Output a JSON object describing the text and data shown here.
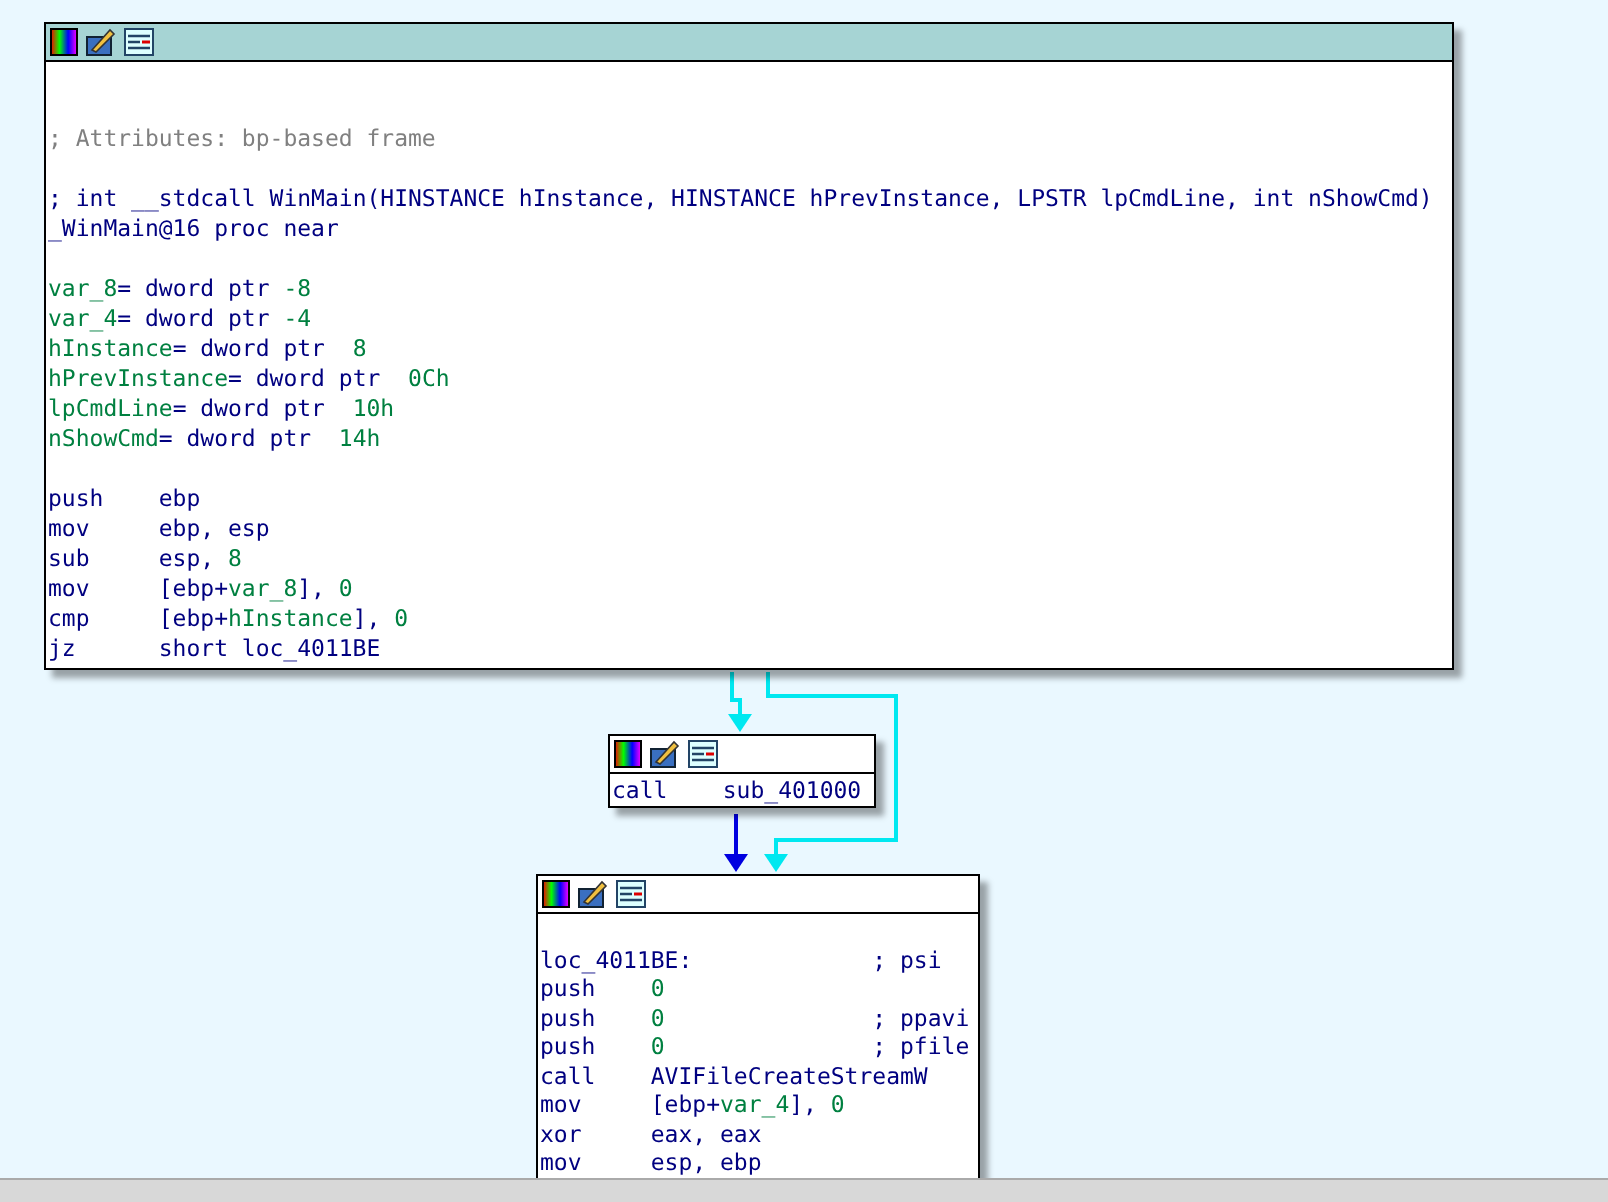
{
  "nodes": [
    {
      "lines": [
        {
          "kind": "blank"
        },
        {
          "kind": "blank"
        },
        {
          "kind": "note",
          "text": "; Attributes: bp-based frame"
        },
        {
          "kind": "blank"
        },
        {
          "kind": "proto",
          "text": "; int __stdcall WinMain(HINSTANCE hInstance, HINSTANCE hPrevInstance, LPSTR lpCmdLine, int nShowCmd)"
        },
        {
          "kind": "proto",
          "text": "_WinMain@16 proc near"
        },
        {
          "kind": "blank"
        },
        {
          "kind": "def",
          "tokens": [
            {
              "text": "var_8",
              "kind": "num"
            },
            {
              "text": "= dword ptr ",
              "kind": "code"
            },
            {
              "text": "-8",
              "kind": "num"
            }
          ]
        },
        {
          "kind": "def",
          "tokens": [
            {
              "text": "var_4",
              "kind": "num"
            },
            {
              "text": "= dword ptr ",
              "kind": "code"
            },
            {
              "text": "-4",
              "kind": "num"
            }
          ]
        },
        {
          "kind": "def",
          "tokens": [
            {
              "text": "hInstance",
              "kind": "num"
            },
            {
              "text": "= dword ptr  ",
              "kind": "code"
            },
            {
              "text": "8",
              "kind": "num"
            }
          ]
        },
        {
          "kind": "def",
          "tokens": [
            {
              "text": "hPrevInstance",
              "kind": "num"
            },
            {
              "text": "= dword ptr  ",
              "kind": "code"
            },
            {
              "text": "0Ch",
              "kind": "num"
            }
          ]
        },
        {
          "kind": "def",
          "tokens": [
            {
              "text": "lpCmdLine",
              "kind": "num"
            },
            {
              "text": "= dword ptr  ",
              "kind": "code"
            },
            {
              "text": "10h",
              "kind": "num"
            }
          ]
        },
        {
          "kind": "def",
          "tokens": [
            {
              "text": "nShowCmd",
              "kind": "num"
            },
            {
              "text": "= dword ptr  ",
              "kind": "code"
            },
            {
              "text": "14h",
              "kind": "num"
            }
          ]
        },
        {
          "kind": "blank"
        },
        {
          "kind": "insn",
          "mnemonic": "push",
          "tokens": [
            {
              "text": "ebp",
              "kind": "code"
            }
          ]
        },
        {
          "kind": "insn",
          "mnemonic": "mov",
          "tokens": [
            {
              "text": "ebp, esp",
              "kind": "code"
            }
          ]
        },
        {
          "kind": "insn",
          "mnemonic": "sub",
          "tokens": [
            {
              "text": "esp, ",
              "kind": "code"
            },
            {
              "text": "8",
              "kind": "num"
            }
          ]
        },
        {
          "kind": "insn",
          "mnemonic": "mov",
          "tokens": [
            {
              "text": "[ebp+",
              "kind": "code"
            },
            {
              "text": "var_8",
              "kind": "num"
            },
            {
              "text": "], ",
              "kind": "code"
            },
            {
              "text": "0",
              "kind": "num"
            }
          ]
        },
        {
          "kind": "insn",
          "mnemonic": "cmp",
          "tokens": [
            {
              "text": "[ebp+",
              "kind": "code"
            },
            {
              "text": "hInstance",
              "kind": "num"
            },
            {
              "text": "], ",
              "kind": "code"
            },
            {
              "text": "0",
              "kind": "num"
            }
          ]
        },
        {
          "kind": "insn",
          "mnemonic": "jz",
          "tokens": [
            {
              "text": "short loc_4011BE",
              "kind": "code"
            }
          ]
        }
      ]
    },
    {
      "lines": [
        {
          "kind": "insn",
          "mnemonic": "call",
          "tokens": [
            {
              "text": "sub_401000",
              "kind": "code"
            }
          ]
        }
      ]
    },
    {
      "lines": [
        {
          "kind": "blank"
        },
        {
          "kind": "label",
          "text": "loc_4011BE:",
          "comment": "; psi"
        },
        {
          "kind": "insn",
          "mnemonic": "push",
          "tokens": [
            {
              "text": "0",
              "kind": "num"
            }
          ]
        },
        {
          "kind": "insn",
          "mnemonic": "push",
          "tokens": [
            {
              "text": "0",
              "kind": "num"
            }
          ],
          "comment": "; ppavi"
        },
        {
          "kind": "insn",
          "mnemonic": "push",
          "tokens": [
            {
              "text": "0",
              "kind": "num"
            }
          ],
          "comment": "; pfile"
        },
        {
          "kind": "insn",
          "mnemonic": "call",
          "tokens": [
            {
              "text": "AVIFileCreateStreamW",
              "kind": "code"
            }
          ]
        },
        {
          "kind": "insn",
          "mnemonic": "mov",
          "tokens": [
            {
              "text": "[ebp+",
              "kind": "code"
            },
            {
              "text": "var_4",
              "kind": "num"
            },
            {
              "text": "], ",
              "kind": "code"
            },
            {
              "text": "0",
              "kind": "num"
            }
          ]
        },
        {
          "kind": "insn",
          "mnemonic": "xor",
          "tokens": [
            {
              "text": "eax, eax",
              "kind": "code"
            }
          ]
        },
        {
          "kind": "insn",
          "mnemonic": "mov",
          "tokens": [
            {
              "text": "esp, ebp",
              "kind": "code"
            }
          ]
        }
      ]
    }
  ],
  "edges": [
    {
      "color": "#00e8f0"
    },
    {
      "color": "#00e8f0"
    },
    {
      "color": "#0000e0"
    }
  ]
}
